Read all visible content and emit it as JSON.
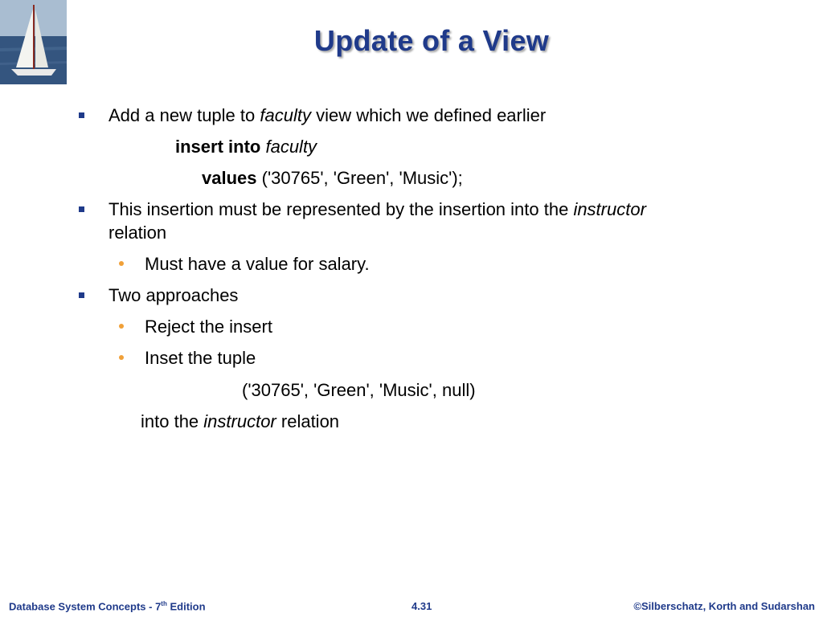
{
  "slide": {
    "title": "Update of a View",
    "bullet1": {
      "pre": "Add a new tuple to ",
      "em": "faculty",
      "post": " view which we defined earlier"
    },
    "code1": {
      "kw": "insert into",
      "em": "faculty"
    },
    "code2": {
      "kw": "values",
      "rest": " ('30765', 'Green', 'Music');"
    },
    "bullet2": {
      "pre": "This insertion must be represented by the insertion into  the ",
      "em": "instructor"
    },
    "bullet2_cont": "relation",
    "sub1": "Must have a  value for salary.",
    "bullet3": "Two approaches",
    "sub2": "Reject the insert",
    "sub3": "Inset the tuple",
    "code3": "('30765', 'Green', 'Music', null)",
    "closing": {
      "pre": "into the ",
      "em": "instructor",
      "post": " relation"
    }
  },
  "footer": {
    "left_main": "Database System Concepts - 7",
    "left_sup": "th",
    "left_end": " Edition",
    "center": "4.31",
    "right": "©Silberschatz, Korth and Sudarshan"
  },
  "colors": {
    "title": "#1f3a8a",
    "bullet_square": "#1f3a8a",
    "bullet_dot": "#f0a038"
  },
  "icons": {
    "logo": "sailboat-logo"
  }
}
